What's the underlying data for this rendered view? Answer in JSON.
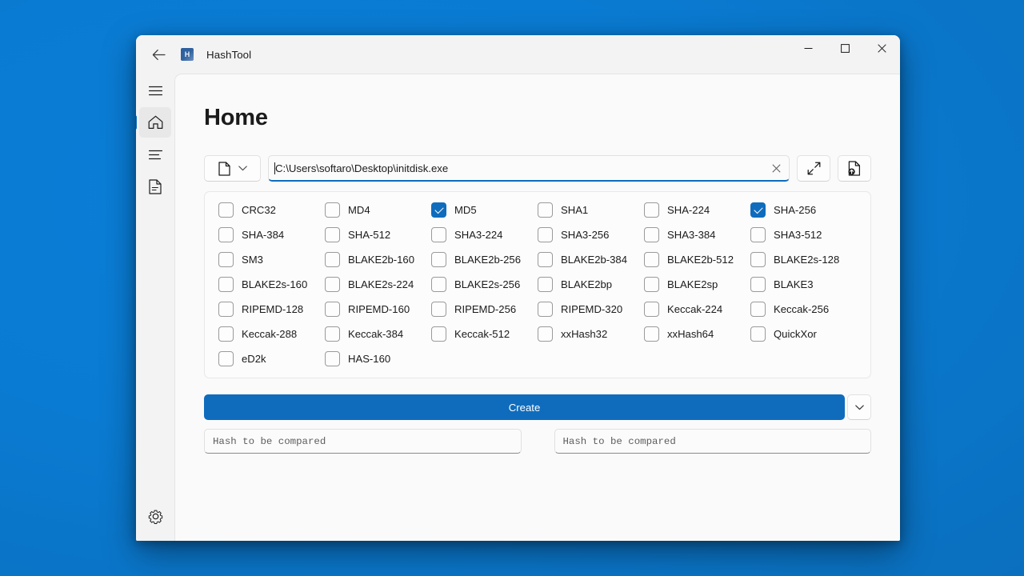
{
  "window": {
    "app_title": "HashTool",
    "app_icon_letter": "H",
    "back_icon": "back-arrow-icon",
    "minimize_label": "—",
    "maximize_label": "□",
    "close_label": "✕"
  },
  "sidebar": {
    "items": [
      {
        "name": "menu",
        "icon": "hamburger-menu-icon",
        "selected": false
      },
      {
        "name": "home",
        "icon": "home-icon",
        "selected": true
      },
      {
        "name": "list",
        "icon": "list-icon",
        "selected": false
      },
      {
        "name": "document",
        "icon": "document-icon",
        "selected": false
      }
    ],
    "bottom_item": {
      "name": "settings",
      "icon": "gear-icon"
    }
  },
  "main": {
    "page_title": "Home",
    "path_row": {
      "type_button_icon": "file-icon",
      "type_button_chevron": "chevron-down-icon",
      "path_value": "C:\\Users\\softaro\\Desktop\\initdisk.exe",
      "clear_icon": "close-icon",
      "expand_icon": "expand-diagonal-icon",
      "upload_icon": "file-upload-icon"
    },
    "algorithms": [
      {
        "label": "CRC32",
        "checked": false
      },
      {
        "label": "MD4",
        "checked": false
      },
      {
        "label": "MD5",
        "checked": true
      },
      {
        "label": "SHA1",
        "checked": false
      },
      {
        "label": "SHA-224",
        "checked": false
      },
      {
        "label": "SHA-256",
        "checked": true
      },
      {
        "label": "SHA-384",
        "checked": false
      },
      {
        "label": "SHA-512",
        "checked": false
      },
      {
        "label": "SHA3-224",
        "checked": false
      },
      {
        "label": "SHA3-256",
        "checked": false
      },
      {
        "label": "SHA3-384",
        "checked": false
      },
      {
        "label": "SHA3-512",
        "checked": false
      },
      {
        "label": "SM3",
        "checked": false
      },
      {
        "label": "BLAKE2b-160",
        "checked": false
      },
      {
        "label": "BLAKE2b-256",
        "checked": false
      },
      {
        "label": "BLAKE2b-384",
        "checked": false
      },
      {
        "label": "BLAKE2b-512",
        "checked": false
      },
      {
        "label": "BLAKE2s-128",
        "checked": false
      },
      {
        "label": "BLAKE2s-160",
        "checked": false
      },
      {
        "label": "BLAKE2s-224",
        "checked": false
      },
      {
        "label": "BLAKE2s-256",
        "checked": false
      },
      {
        "label": "BLAKE2bp",
        "checked": false
      },
      {
        "label": "BLAKE2sp",
        "checked": false
      },
      {
        "label": "BLAKE3",
        "checked": false
      },
      {
        "label": "RIPEMD-128",
        "checked": false
      },
      {
        "label": "RIPEMD-160",
        "checked": false
      },
      {
        "label": "RIPEMD-256",
        "checked": false
      },
      {
        "label": "RIPEMD-320",
        "checked": false
      },
      {
        "label": "Keccak-224",
        "checked": false
      },
      {
        "label": "Keccak-256",
        "checked": false
      },
      {
        "label": "Keccak-288",
        "checked": false
      },
      {
        "label": "Keccak-384",
        "checked": false
      },
      {
        "label": "Keccak-512",
        "checked": false
      },
      {
        "label": "xxHash32",
        "checked": false
      },
      {
        "label": "xxHash64",
        "checked": false
      },
      {
        "label": "QuickXor",
        "checked": false
      },
      {
        "label": "eD2k",
        "checked": false
      },
      {
        "label": "HAS-160",
        "checked": false
      }
    ],
    "create": {
      "label": "Create",
      "dropdown_icon": "chevron-down-icon"
    },
    "compare": {
      "left_placeholder": "Hash to be compared",
      "left_value": "",
      "right_placeholder": "Hash to be compared",
      "right_value": ""
    }
  },
  "colors": {
    "accent": "#0f6cbd",
    "desktop": "#0a7bd2",
    "window_bg": "#f3f3f3",
    "content_bg": "#fafafa",
    "text": "#1b1b1b"
  }
}
